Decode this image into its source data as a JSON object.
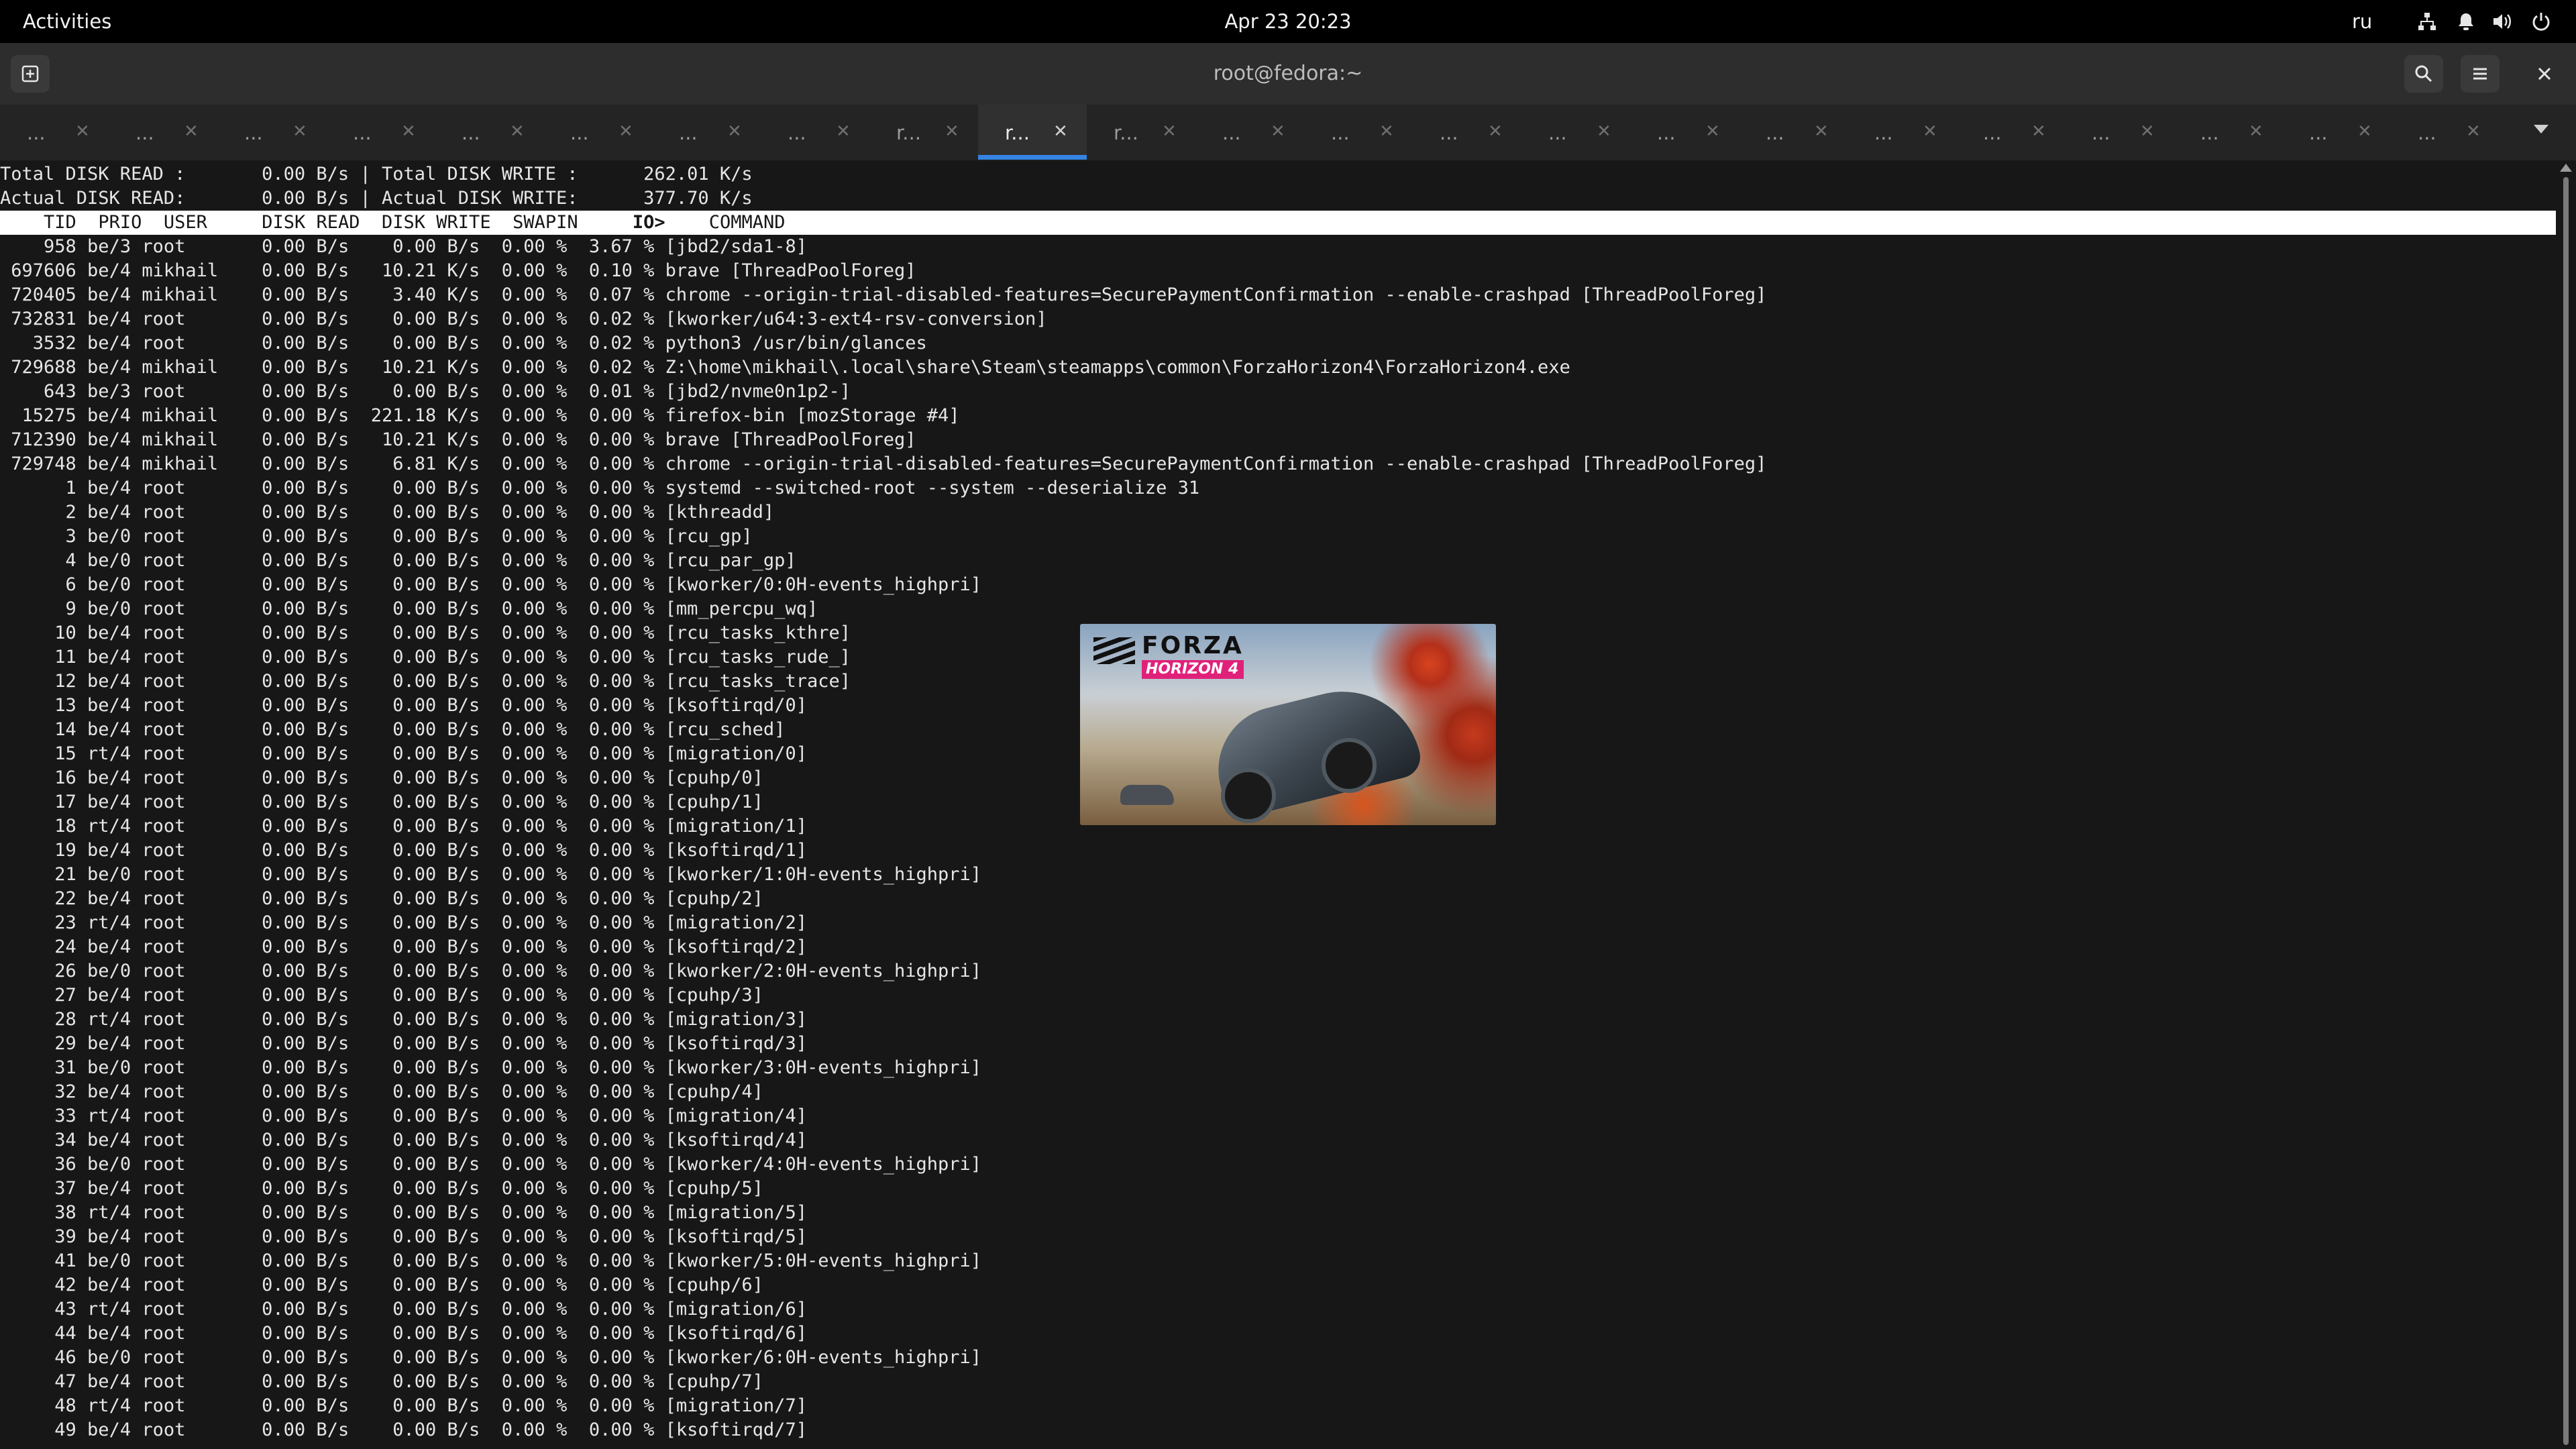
{
  "topbar": {
    "activities": "Activities",
    "clock": "Apr 23  20:23",
    "lang": "ru"
  },
  "window": {
    "title": "root@fedora:~"
  },
  "tabs": [
    "...",
    "...",
    "...",
    "...",
    "...",
    "...",
    "...",
    "...",
    "r...",
    "r...",
    "r...",
    "...",
    "...",
    "...",
    "...",
    "...",
    "...",
    "...",
    "...",
    "...",
    "...",
    "...",
    "..."
  ],
  "active_tab": 9,
  "iotop": {
    "total_read_label": "Total DISK READ :",
    "total_read": "0.00 B/s",
    "total_write_label": "Total DISK WRITE :",
    "total_write": "262.01 K/s",
    "actual_read_label": "Actual DISK READ:",
    "actual_read": "0.00 B/s",
    "actual_write_label": "Actual DISK WRITE:",
    "actual_write": "377.70 K/s",
    "columns": {
      "tid": "TID",
      "prio": "PRIO",
      "user": "USER",
      "disk_read": "DISK READ",
      "disk_write": "DISK WRITE",
      "swapin": "SWAPIN",
      "io": "IO>",
      "command": "COMMAND"
    },
    "rows": [
      {
        "tid": "958",
        "prio": "be/3",
        "user": "root",
        "read": "0.00 B/s",
        "write": "0.00 B/s",
        "swapin": "0.00 %",
        "io": "3.67 %",
        "cmd": "[jbd2/sda1-8]"
      },
      {
        "tid": "697606",
        "prio": "be/4",
        "user": "mikhail",
        "read": "0.00 B/s",
        "write": "10.21 K/s",
        "swapin": "0.00 %",
        "io": "0.10 %",
        "cmd": "brave [ThreadPoolForeg]"
      },
      {
        "tid": "720405",
        "prio": "be/4",
        "user": "mikhail",
        "read": "0.00 B/s",
        "write": "3.40 K/s",
        "swapin": "0.00 %",
        "io": "0.07 %",
        "cmd": "chrome --origin-trial-disabled-features=SecurePaymentConfirmation --enable-crashpad [ThreadPoolForeg]"
      },
      {
        "tid": "732831",
        "prio": "be/4",
        "user": "root",
        "read": "0.00 B/s",
        "write": "0.00 B/s",
        "swapin": "0.00 %",
        "io": "0.02 %",
        "cmd": "[kworker/u64:3-ext4-rsv-conversion]"
      },
      {
        "tid": "3532",
        "prio": "be/4",
        "user": "root",
        "read": "0.00 B/s",
        "write": "0.00 B/s",
        "swapin": "0.00 %",
        "io": "0.02 %",
        "cmd": "python3 /usr/bin/glances"
      },
      {
        "tid": "729688",
        "prio": "be/4",
        "user": "mikhail",
        "read": "0.00 B/s",
        "write": "10.21 K/s",
        "swapin": "0.00 %",
        "io": "0.02 %",
        "cmd": "Z:\\home\\mikhail\\.local\\share\\Steam\\steamapps\\common\\ForzaHorizon4\\ForzaHorizon4.exe"
      },
      {
        "tid": "643",
        "prio": "be/3",
        "user": "root",
        "read": "0.00 B/s",
        "write": "0.00 B/s",
        "swapin": "0.00 %",
        "io": "0.01 %",
        "cmd": "[jbd2/nvme0n1p2-]"
      },
      {
        "tid": "15275",
        "prio": "be/4",
        "user": "mikhail",
        "read": "0.00 B/s",
        "write": "221.18 K/s",
        "swapin": "0.00 %",
        "io": "0.00 %",
        "cmd": "firefox-bin [mozStorage #4]"
      },
      {
        "tid": "712390",
        "prio": "be/4",
        "user": "mikhail",
        "read": "0.00 B/s",
        "write": "10.21 K/s",
        "swapin": "0.00 %",
        "io": "0.00 %",
        "cmd": "brave [ThreadPoolForeg]"
      },
      {
        "tid": "729748",
        "prio": "be/4",
        "user": "mikhail",
        "read": "0.00 B/s",
        "write": "6.81 K/s",
        "swapin": "0.00 %",
        "io": "0.00 %",
        "cmd": "chrome --origin-trial-disabled-features=SecurePaymentConfirmation --enable-crashpad [ThreadPoolForeg]"
      },
      {
        "tid": "1",
        "prio": "be/4",
        "user": "root",
        "read": "0.00 B/s",
        "write": "0.00 B/s",
        "swapin": "0.00 %",
        "io": "0.00 %",
        "cmd": "systemd --switched-root --system --deserialize 31"
      },
      {
        "tid": "2",
        "prio": "be/4",
        "user": "root",
        "read": "0.00 B/s",
        "write": "0.00 B/s",
        "swapin": "0.00 %",
        "io": "0.00 %",
        "cmd": "[kthreadd]"
      },
      {
        "tid": "3",
        "prio": "be/0",
        "user": "root",
        "read": "0.00 B/s",
        "write": "0.00 B/s",
        "swapin": "0.00 %",
        "io": "0.00 %",
        "cmd": "[rcu_gp]"
      },
      {
        "tid": "4",
        "prio": "be/0",
        "user": "root",
        "read": "0.00 B/s",
        "write": "0.00 B/s",
        "swapin": "0.00 %",
        "io": "0.00 %",
        "cmd": "[rcu_par_gp]"
      },
      {
        "tid": "6",
        "prio": "be/0",
        "user": "root",
        "read": "0.00 B/s",
        "write": "0.00 B/s",
        "swapin": "0.00 %",
        "io": "0.00 %",
        "cmd": "[kworker/0:0H-events_highpri]"
      },
      {
        "tid": "9",
        "prio": "be/0",
        "user": "root",
        "read": "0.00 B/s",
        "write": "0.00 B/s",
        "swapin": "0.00 %",
        "io": "0.00 %",
        "cmd": "[mm_percpu_wq]"
      },
      {
        "tid": "10",
        "prio": "be/4",
        "user": "root",
        "read": "0.00 B/s",
        "write": "0.00 B/s",
        "swapin": "0.00 %",
        "io": "0.00 %",
        "cmd": "[rcu_tasks_kthre]"
      },
      {
        "tid": "11",
        "prio": "be/4",
        "user": "root",
        "read": "0.00 B/s",
        "write": "0.00 B/s",
        "swapin": "0.00 %",
        "io": "0.00 %",
        "cmd": "[rcu_tasks_rude_]"
      },
      {
        "tid": "12",
        "prio": "be/4",
        "user": "root",
        "read": "0.00 B/s",
        "write": "0.00 B/s",
        "swapin": "0.00 %",
        "io": "0.00 %",
        "cmd": "[rcu_tasks_trace]"
      },
      {
        "tid": "13",
        "prio": "be/4",
        "user": "root",
        "read": "0.00 B/s",
        "write": "0.00 B/s",
        "swapin": "0.00 %",
        "io": "0.00 %",
        "cmd": "[ksoftirqd/0]"
      },
      {
        "tid": "14",
        "prio": "be/4",
        "user": "root",
        "read": "0.00 B/s",
        "write": "0.00 B/s",
        "swapin": "0.00 %",
        "io": "0.00 %",
        "cmd": "[rcu_sched]"
      },
      {
        "tid": "15",
        "prio": "rt/4",
        "user": "root",
        "read": "0.00 B/s",
        "write": "0.00 B/s",
        "swapin": "0.00 %",
        "io": "0.00 %",
        "cmd": "[migration/0]"
      },
      {
        "tid": "16",
        "prio": "be/4",
        "user": "root",
        "read": "0.00 B/s",
        "write": "0.00 B/s",
        "swapin": "0.00 %",
        "io": "0.00 %",
        "cmd": "[cpuhp/0]"
      },
      {
        "tid": "17",
        "prio": "be/4",
        "user": "root",
        "read": "0.00 B/s",
        "write": "0.00 B/s",
        "swapin": "0.00 %",
        "io": "0.00 %",
        "cmd": "[cpuhp/1]"
      },
      {
        "tid": "18",
        "prio": "rt/4",
        "user": "root",
        "read": "0.00 B/s",
        "write": "0.00 B/s",
        "swapin": "0.00 %",
        "io": "0.00 %",
        "cmd": "[migration/1]"
      },
      {
        "tid": "19",
        "prio": "be/4",
        "user": "root",
        "read": "0.00 B/s",
        "write": "0.00 B/s",
        "swapin": "0.00 %",
        "io": "0.00 %",
        "cmd": "[ksoftirqd/1]"
      },
      {
        "tid": "21",
        "prio": "be/0",
        "user": "root",
        "read": "0.00 B/s",
        "write": "0.00 B/s",
        "swapin": "0.00 %",
        "io": "0.00 %",
        "cmd": "[kworker/1:0H-events_highpri]"
      },
      {
        "tid": "22",
        "prio": "be/4",
        "user": "root",
        "read": "0.00 B/s",
        "write": "0.00 B/s",
        "swapin": "0.00 %",
        "io": "0.00 %",
        "cmd": "[cpuhp/2]"
      },
      {
        "tid": "23",
        "prio": "rt/4",
        "user": "root",
        "read": "0.00 B/s",
        "write": "0.00 B/s",
        "swapin": "0.00 %",
        "io": "0.00 %",
        "cmd": "[migration/2]"
      },
      {
        "tid": "24",
        "prio": "be/4",
        "user": "root",
        "read": "0.00 B/s",
        "write": "0.00 B/s",
        "swapin": "0.00 %",
        "io": "0.00 %",
        "cmd": "[ksoftirqd/2]"
      },
      {
        "tid": "26",
        "prio": "be/0",
        "user": "root",
        "read": "0.00 B/s",
        "write": "0.00 B/s",
        "swapin": "0.00 %",
        "io": "0.00 %",
        "cmd": "[kworker/2:0H-events_highpri]"
      },
      {
        "tid": "27",
        "prio": "be/4",
        "user": "root",
        "read": "0.00 B/s",
        "write": "0.00 B/s",
        "swapin": "0.00 %",
        "io": "0.00 %",
        "cmd": "[cpuhp/3]"
      },
      {
        "tid": "28",
        "prio": "rt/4",
        "user": "root",
        "read": "0.00 B/s",
        "write": "0.00 B/s",
        "swapin": "0.00 %",
        "io": "0.00 %",
        "cmd": "[migration/3]"
      },
      {
        "tid": "29",
        "prio": "be/4",
        "user": "root",
        "read": "0.00 B/s",
        "write": "0.00 B/s",
        "swapin": "0.00 %",
        "io": "0.00 %",
        "cmd": "[ksoftirqd/3]"
      },
      {
        "tid": "31",
        "prio": "be/0",
        "user": "root",
        "read": "0.00 B/s",
        "write": "0.00 B/s",
        "swapin": "0.00 %",
        "io": "0.00 %",
        "cmd": "[kworker/3:0H-events_highpri]"
      },
      {
        "tid": "32",
        "prio": "be/4",
        "user": "root",
        "read": "0.00 B/s",
        "write": "0.00 B/s",
        "swapin": "0.00 %",
        "io": "0.00 %",
        "cmd": "[cpuhp/4]"
      },
      {
        "tid": "33",
        "prio": "rt/4",
        "user": "root",
        "read": "0.00 B/s",
        "write": "0.00 B/s",
        "swapin": "0.00 %",
        "io": "0.00 %",
        "cmd": "[migration/4]"
      },
      {
        "tid": "34",
        "prio": "be/4",
        "user": "root",
        "read": "0.00 B/s",
        "write": "0.00 B/s",
        "swapin": "0.00 %",
        "io": "0.00 %",
        "cmd": "[ksoftirqd/4]"
      },
      {
        "tid": "36",
        "prio": "be/0",
        "user": "root",
        "read": "0.00 B/s",
        "write": "0.00 B/s",
        "swapin": "0.00 %",
        "io": "0.00 %",
        "cmd": "[kworker/4:0H-events_highpri]"
      },
      {
        "tid": "37",
        "prio": "be/4",
        "user": "root",
        "read": "0.00 B/s",
        "write": "0.00 B/s",
        "swapin": "0.00 %",
        "io": "0.00 %",
        "cmd": "[cpuhp/5]"
      },
      {
        "tid": "38",
        "prio": "rt/4",
        "user": "root",
        "read": "0.00 B/s",
        "write": "0.00 B/s",
        "swapin": "0.00 %",
        "io": "0.00 %",
        "cmd": "[migration/5]"
      },
      {
        "tid": "39",
        "prio": "be/4",
        "user": "root",
        "read": "0.00 B/s",
        "write": "0.00 B/s",
        "swapin": "0.00 %",
        "io": "0.00 %",
        "cmd": "[ksoftirqd/5]"
      },
      {
        "tid": "41",
        "prio": "be/0",
        "user": "root",
        "read": "0.00 B/s",
        "write": "0.00 B/s",
        "swapin": "0.00 %",
        "io": "0.00 %",
        "cmd": "[kworker/5:0H-events_highpri]"
      },
      {
        "tid": "42",
        "prio": "be/4",
        "user": "root",
        "read": "0.00 B/s",
        "write": "0.00 B/s",
        "swapin": "0.00 %",
        "io": "0.00 %",
        "cmd": "[cpuhp/6]"
      },
      {
        "tid": "43",
        "prio": "rt/4",
        "user": "root",
        "read": "0.00 B/s",
        "write": "0.00 B/s",
        "swapin": "0.00 %",
        "io": "0.00 %",
        "cmd": "[migration/6]"
      },
      {
        "tid": "44",
        "prio": "be/4",
        "user": "root",
        "read": "0.00 B/s",
        "write": "0.00 B/s",
        "swapin": "0.00 %",
        "io": "0.00 %",
        "cmd": "[ksoftirqd/6]"
      },
      {
        "tid": "46",
        "prio": "be/0",
        "user": "root",
        "read": "0.00 B/s",
        "write": "0.00 B/s",
        "swapin": "0.00 %",
        "io": "0.00 %",
        "cmd": "[kworker/6:0H-events_highpri]"
      },
      {
        "tid": "47",
        "prio": "be/4",
        "user": "root",
        "read": "0.00 B/s",
        "write": "0.00 B/s",
        "swapin": "0.00 %",
        "io": "0.00 %",
        "cmd": "[cpuhp/7]"
      },
      {
        "tid": "48",
        "prio": "rt/4",
        "user": "root",
        "read": "0.00 B/s",
        "write": "0.00 B/s",
        "swapin": "0.00 %",
        "io": "0.00 %",
        "cmd": "[migration/7]"
      },
      {
        "tid": "49",
        "prio": "be/4",
        "user": "root",
        "read": "0.00 B/s",
        "write": "0.00 B/s",
        "swapin": "0.00 %",
        "io": "0.00 %",
        "cmd": "[ksoftirqd/7]"
      }
    ]
  },
  "overlay": {
    "logo_line1": "FORZA",
    "logo_line2": "HORIZON 4"
  },
  "icons": {
    "new_tab": "new-tab-icon",
    "search": "search-icon",
    "menu": "menu-icon",
    "close": "close-icon",
    "network": "network-icon",
    "notifications": "bell-icon",
    "volume": "volume-icon",
    "power": "power-icon",
    "tab_list": "chevron-down-icon"
  },
  "colors": {
    "accent": "#3584e4",
    "terminal_bg": "#171717",
    "header_bg": "#2d2d2d",
    "topbar_bg": "#000000",
    "forza_pink": "#e0217a"
  }
}
